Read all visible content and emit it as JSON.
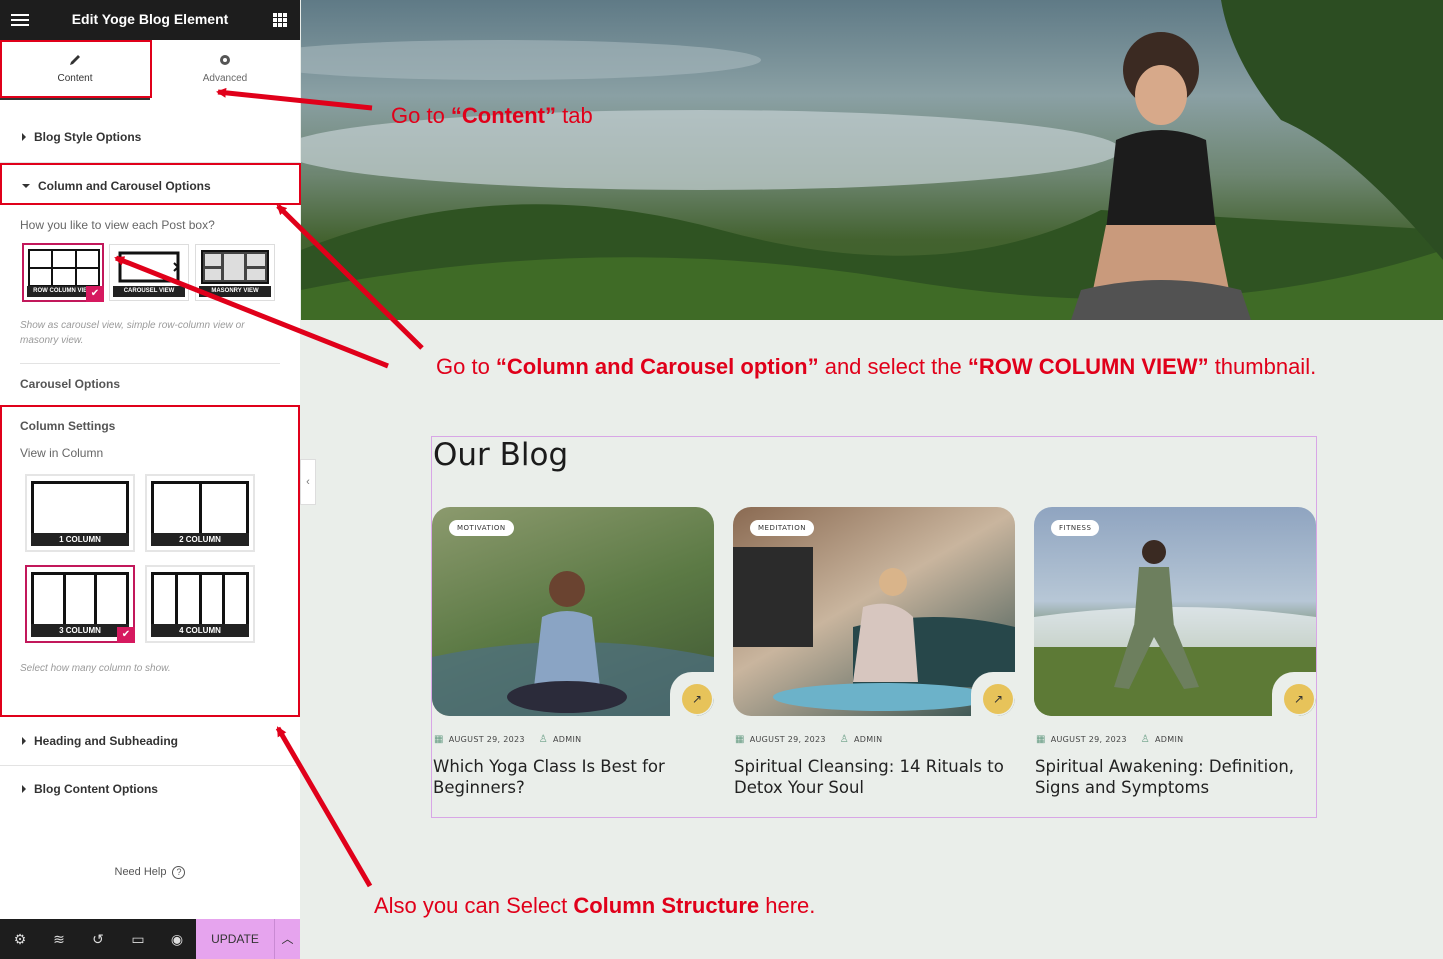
{
  "panel": {
    "title": "Edit Yoge Blog Element",
    "tabs": [
      {
        "label": "Content"
      },
      {
        "label": "Advanced"
      }
    ],
    "sections": {
      "blog_style": "Blog Style Options",
      "column_carousel": "Column and Carousel Options",
      "heading_subheading": "Heading and Subheading",
      "blog_content": "Blog Content Options"
    },
    "view_question": "How you like to view each Post box?",
    "view_options": [
      {
        "label": "ROW COLUMN VIEW",
        "selected": true
      },
      {
        "label": "CAROUSEL VIEW",
        "selected": false
      },
      {
        "label": "MASONRY VIEW",
        "selected": false
      }
    ],
    "view_hint": "Show as carousel view, simple row-column view or masonry view.",
    "carousel_options": "Carousel Options",
    "column_settings": "Column Settings",
    "view_in_column": "View in Column",
    "column_options": [
      {
        "label": "1 COLUMN",
        "cols": 1,
        "selected": false
      },
      {
        "label": "2 COLUMN",
        "cols": 2,
        "selected": false
      },
      {
        "label": "3 COLUMN",
        "cols": 3,
        "selected": true
      },
      {
        "label": "4 COLUMN",
        "cols": 4,
        "selected": false
      }
    ],
    "column_hint": "Select how many column to show.",
    "need_help": "Need Help",
    "update_label": "UPDATE",
    "check_glyph": "✔"
  },
  "blog": {
    "heading": "Our Blog",
    "posts": [
      {
        "category": "MOTIVATION",
        "date": "AUGUST 29, 2023",
        "author": "ADMIN",
        "title": "Which Yoga Class Is Best for Beginners?",
        "colors": [
          "#5c7a45",
          "#8c9a6e",
          "#3e5632"
        ]
      },
      {
        "category": "MEDITATION",
        "date": "AUGUST 29, 2023",
        "author": "ADMIN",
        "title": "Spiritual Cleansing: 14 Rituals to Detox Your Soul",
        "colors": [
          "#8a6a52",
          "#c9b59e",
          "#2f4d4d"
        ]
      },
      {
        "category": "FITNESS",
        "date": "AUGUST 29, 2023",
        "author": "ADMIN",
        "title": "Spiritual Awakening: Definition, Signs and Symptoms",
        "colors": [
          "#8fa4c0",
          "#b7c7d6",
          "#4d6a30"
        ]
      }
    ]
  },
  "annotations": {
    "content_tab": {
      "prefix": "Go  to ",
      "bold": "“Content”",
      "suffix": " tab"
    },
    "column_carousel": {
      "prefix": "Go to ",
      "bold1": "“Column and Carousel option”",
      "mid": " and select the ",
      "bold2": "“ROW COLUMN VIEW”",
      "suffix": " thumbnail."
    },
    "column_structure": {
      "prefix": "Also you can Select ",
      "bold": "Column Structure",
      "suffix": " here."
    }
  },
  "colors": {
    "annotation_red": "#e0001a",
    "selected_pink": "#c2185b",
    "update_bg": "#e6a4ee",
    "arrow_btn": "#e7c35a"
  }
}
